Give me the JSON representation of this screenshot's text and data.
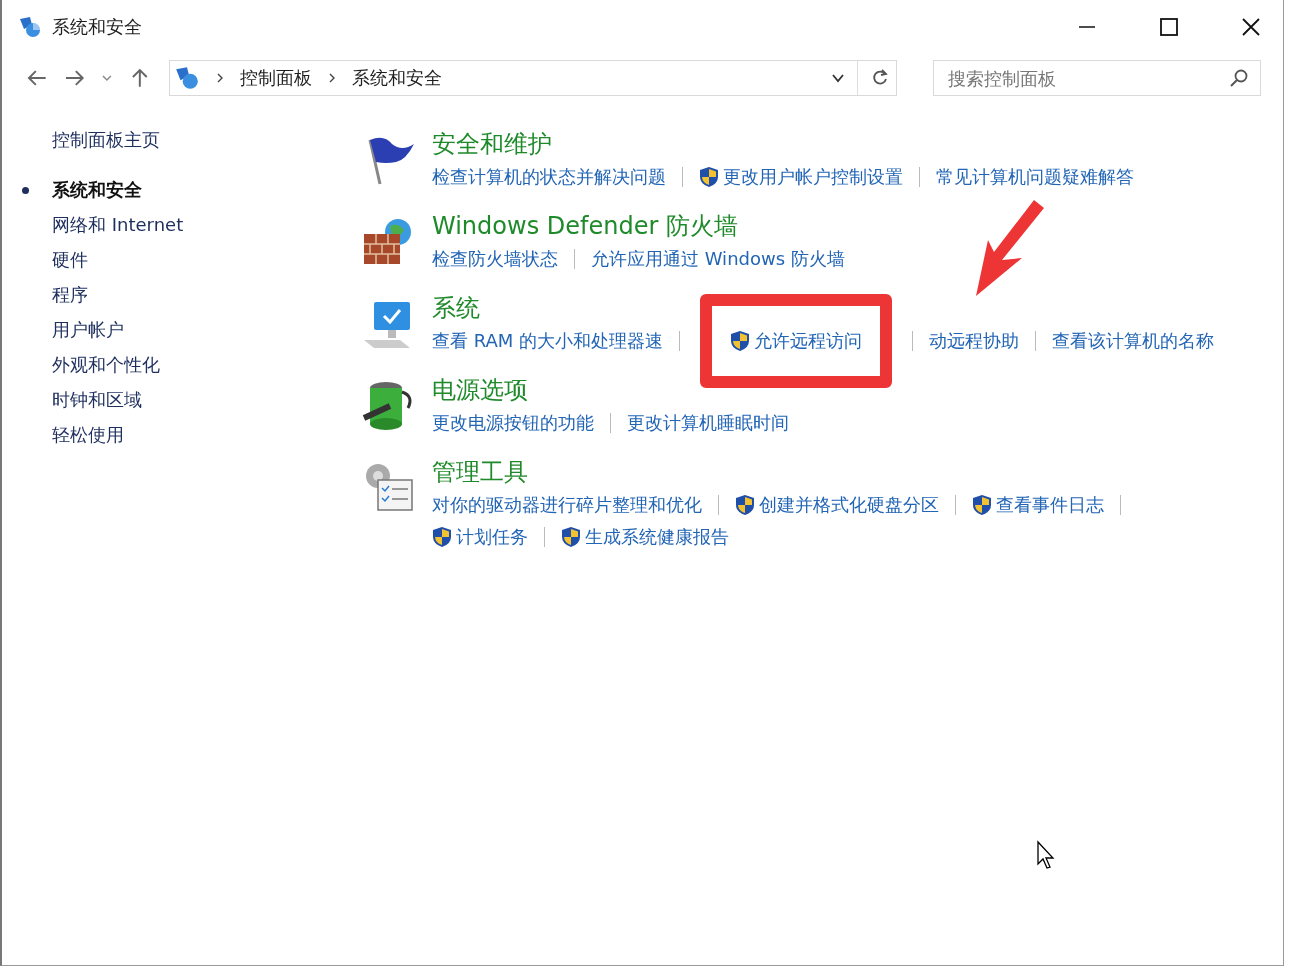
{
  "window": {
    "title": "系统和安全"
  },
  "address_bar": {
    "breadcrumbs": [
      "控制面板",
      "系统和安全"
    ]
  },
  "search": {
    "placeholder": "搜索控制面板"
  },
  "sidebar": {
    "home": "控制面板主页",
    "items": [
      {
        "label": "系统和安全",
        "selected": true
      },
      {
        "label": "网络和 Internet",
        "selected": false
      },
      {
        "label": "硬件",
        "selected": false
      },
      {
        "label": "程序",
        "selected": false
      },
      {
        "label": "用户帐户",
        "selected": false
      },
      {
        "label": "外观和个性化",
        "selected": false
      },
      {
        "label": "时钟和区域",
        "selected": false
      },
      {
        "label": "轻松使用",
        "selected": false
      }
    ]
  },
  "sections": [
    {
      "kind": "flag",
      "title": "安全和维护",
      "links": [
        [
          {
            "text": "检查计算机的状态并解决问题",
            "shield": false,
            "highlighted": false
          },
          {
            "text": "更改用户帐户控制设置",
            "shield": true,
            "highlighted": false
          },
          {
            "text": "常见计算机问题疑难解答",
            "shield": false,
            "highlighted": false
          }
        ]
      ]
    },
    {
      "kind": "firewall",
      "title": "Windows Defender 防火墙",
      "links": [
        [
          {
            "text": "检查防火墙状态",
            "shield": false,
            "highlighted": false
          },
          {
            "text": "允许应用通过 Windows 防火墙",
            "shield": false,
            "highlighted": false
          }
        ]
      ]
    },
    {
      "kind": "monitor",
      "title": "系统",
      "links": [
        [
          {
            "text": "查看 RAM 的大小和处理器速",
            "shield": false,
            "highlighted": false
          },
          {
            "text": "允许远程访问",
            "shield": true,
            "highlighted": true
          },
          {
            "text": "动远程协助",
            "shield": false,
            "highlighted": false
          },
          {
            "text": "查看该计算机的名称",
            "shield": false,
            "highlighted": false
          }
        ]
      ]
    },
    {
      "kind": "battery",
      "title": "电源选项",
      "links": [
        [
          {
            "text": "更改电源按钮的功能",
            "shield": false,
            "highlighted": false
          },
          {
            "text": "更改计算机睡眠时间",
            "shield": false,
            "highlighted": false
          }
        ]
      ]
    },
    {
      "kind": "tools",
      "title": "管理工具",
      "links": [
        [
          {
            "text": "对你的驱动器进行碎片整理和优化",
            "shield": false,
            "highlighted": false
          },
          {
            "text": "创建并格式化硬盘分区",
            "shield": true,
            "highlighted": false
          },
          {
            "text": "查看事件日志",
            "shield": true,
            "highlighted": false
          }
        ],
        [
          {
            "text": "计划任务",
            "shield": true,
            "highlighted": false
          },
          {
            "text": "生成系统健康报告",
            "shield": true,
            "highlighted": false
          }
        ]
      ]
    }
  ]
}
